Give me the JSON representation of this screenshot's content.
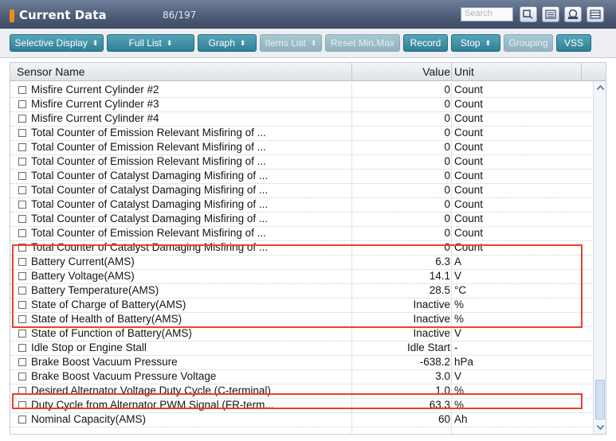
{
  "window": {
    "title": "Current Data",
    "count": "86/197"
  },
  "search": {
    "placeholder": "Search"
  },
  "toolbar": {
    "selective_display": "Selective Display",
    "full_list": "Full List",
    "graph": "Graph",
    "items_list": "Items List",
    "reset_min_max": "Reset Min.Max",
    "record": "Record",
    "stop": "Stop",
    "grouping": "Grouping",
    "vss": "VSS"
  },
  "table": {
    "headers": {
      "name": "Sensor Name",
      "value": "Value",
      "unit": "Unit"
    },
    "rows": [
      {
        "name": "Misfire Current Cylinder #2",
        "value": "0",
        "unit": "Count"
      },
      {
        "name": "Misfire Current Cylinder #3",
        "value": "0",
        "unit": "Count"
      },
      {
        "name": "Misfire Current Cylinder #4",
        "value": "0",
        "unit": "Count"
      },
      {
        "name": "Total Counter of Emission Relevant Misfiring of ...",
        "value": "0",
        "unit": "Count"
      },
      {
        "name": "Total Counter of Emission Relevant Misfiring of ...",
        "value": "0",
        "unit": "Count"
      },
      {
        "name": "Total Counter of Emission Relevant Misfiring of ...",
        "value": "0",
        "unit": "Count"
      },
      {
        "name": "Total Counter of Catalyst Damaging Misfiring of ...",
        "value": "0",
        "unit": "Count"
      },
      {
        "name": "Total Counter of Catalyst Damaging Misfiring of ...",
        "value": "0",
        "unit": "Count"
      },
      {
        "name": "Total Counter of Catalyst Damaging Misfiring of ...",
        "value": "0",
        "unit": "Count"
      },
      {
        "name": "Total Counter of Catalyst Damaging Misfiring of ...",
        "value": "0",
        "unit": "Count"
      },
      {
        "name": "Total Counter of Emission Relevant Misfiring of ...",
        "value": "0",
        "unit": "Count"
      },
      {
        "name": "Total Counter of Catalyst Damaging Misfiring of ...",
        "value": "0",
        "unit": "Count"
      },
      {
        "name": "Battery Current(AMS)",
        "value": "6.3",
        "unit": "A"
      },
      {
        "name": "Battery Voltage(AMS)",
        "value": "14.1",
        "unit": "V"
      },
      {
        "name": "Battery Temperature(AMS)",
        "value": "28.5",
        "unit": "°C"
      },
      {
        "name": "State of Charge of Battery(AMS)",
        "value": "Inactive",
        "unit": "%"
      },
      {
        "name": "State of Health of Battery(AMS)",
        "value": "Inactive",
        "unit": "%"
      },
      {
        "name": "State of Function of Battery(AMS)",
        "value": "Inactive",
        "unit": "V"
      },
      {
        "name": "Idle Stop or Engine Stall",
        "value": "Idle Start",
        "unit": "-"
      },
      {
        "name": "Brake Boost Vacuum Pressure",
        "value": "-638.2",
        "unit": "hPa"
      },
      {
        "name": "Brake Boost Vacuum Pressure Voltage",
        "value": "3.0",
        "unit": "V"
      },
      {
        "name": "Desired Alternator Voltage Duty Cycle (C-terminal)",
        "value": "1.0",
        "unit": "%"
      },
      {
        "name": "Duty Cycle from Alternator PWM Signal (FR-term...",
        "value": "63.3",
        "unit": "%"
      },
      {
        "name": "Nominal Capacity(AMS)",
        "value": "60",
        "unit": "Ah"
      }
    ]
  },
  "colors": {
    "highlight": "#e8412f",
    "button": "#2f7f95",
    "titlebar": "#4e5d78"
  },
  "icons": [
    "search-icon",
    "list-icon",
    "setting-icon",
    "panel-icon"
  ]
}
